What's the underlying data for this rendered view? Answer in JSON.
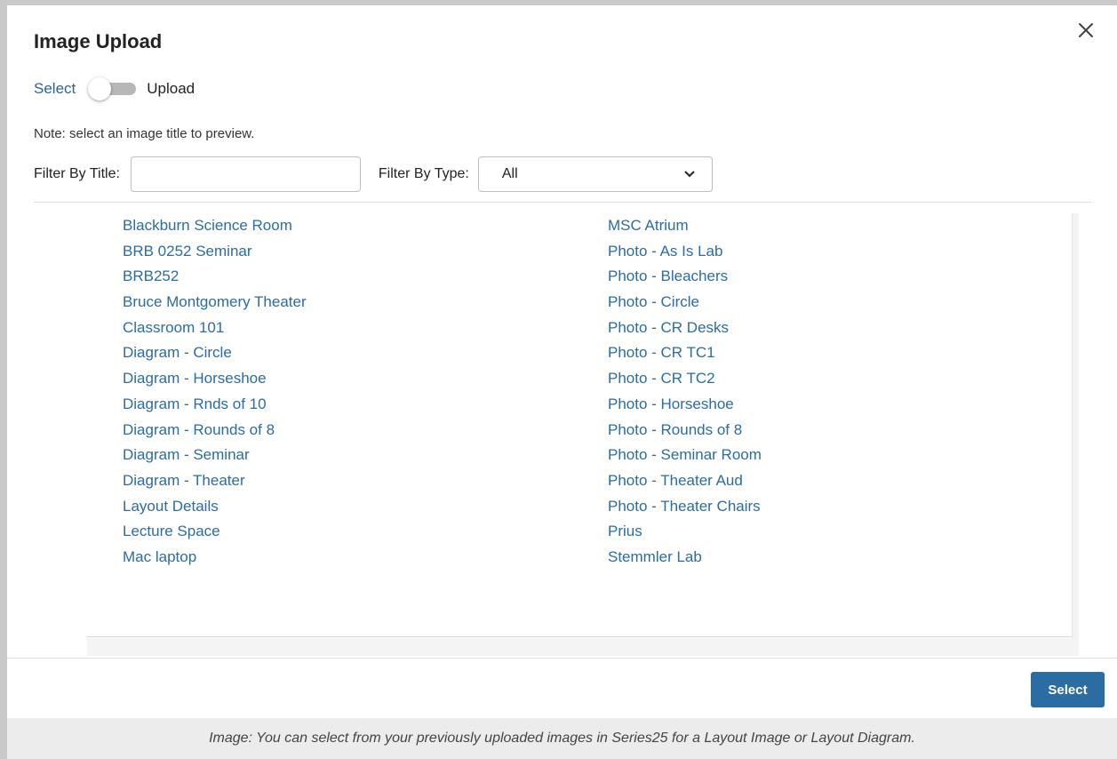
{
  "dialog": {
    "title": "Image Upload",
    "close_icon": "close-icon"
  },
  "mode_toggle": {
    "left_label": "Select",
    "right_label": "Upload",
    "state": "Select"
  },
  "note": "Note: select an image title to preview.",
  "filters": {
    "title_label": "Filter By Title:",
    "title_value": "",
    "type_label": "Filter By Type:",
    "type_selected": "All"
  },
  "images": {
    "left_column": [
      "Blackburn Science Room",
      "BRB 0252 Seminar",
      "BRB252",
      "Bruce Montgomery Theater",
      "Classroom 101",
      "Diagram - Circle",
      "Diagram - Horseshoe",
      "Diagram - Rnds of 10",
      "Diagram - Rounds of 8",
      "Diagram - Seminar",
      "Diagram - Theater",
      "Layout Details",
      "Lecture Space",
      "Mac laptop"
    ],
    "right_column": [
      "MSC Atrium",
      "Photo - As Is Lab",
      "Photo - Bleachers",
      "Photo - Circle",
      "Photo - CR Desks",
      "Photo - CR TC1",
      "Photo - CR TC2",
      "Photo - Horseshoe",
      "Photo - Rounds of 8",
      "Photo - Seminar Room",
      "Photo - Theater Aud",
      "Photo - Theater Chairs",
      "Prius",
      "Stemmler Lab"
    ]
  },
  "footer": {
    "select_button": "Select"
  },
  "caption": "Image: You can select from your previously uploaded images in Series25 for a Layout Image or Layout Diagram.",
  "colors": {
    "link": "#2b6ca3",
    "button": "#2b6ca3",
    "caption_bar": "#ececec"
  }
}
